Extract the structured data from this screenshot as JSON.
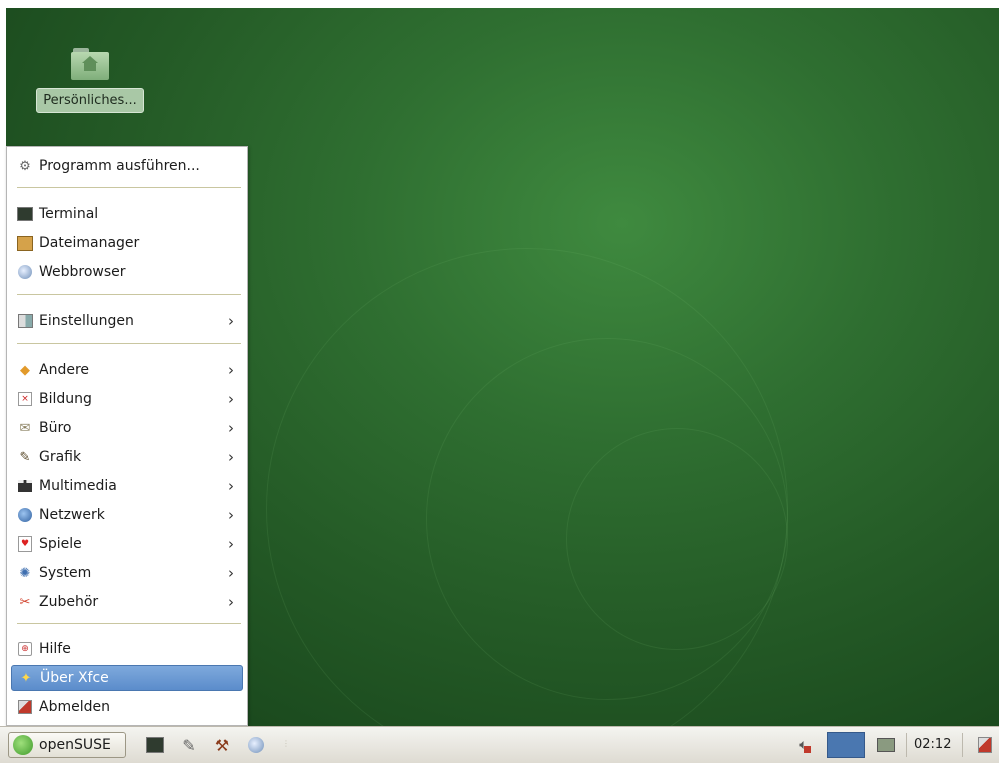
{
  "desktop": {
    "icon_label": "Persönliches..."
  },
  "menu": {
    "run": {
      "label": "Programm ausführen...",
      "icon": "run-program-icon"
    },
    "favorites": [
      {
        "label": "Terminal",
        "icon": "terminal-icon"
      },
      {
        "label": "Dateimanager",
        "icon": "file-manager-icon"
      },
      {
        "label": "Webbrowser",
        "icon": "web-browser-icon"
      }
    ],
    "settings": {
      "label": "Einstellungen",
      "icon": "settings-icon"
    },
    "categories": [
      {
        "label": "Andere",
        "icon": "other-icon"
      },
      {
        "label": "Bildung",
        "icon": "education-icon"
      },
      {
        "label": "Büro",
        "icon": "office-icon"
      },
      {
        "label": "Grafik",
        "icon": "graphics-icon"
      },
      {
        "label": "Multimedia",
        "icon": "multimedia-icon"
      },
      {
        "label": "Netzwerk",
        "icon": "network-icon"
      },
      {
        "label": "Spiele",
        "icon": "games-icon"
      },
      {
        "label": "System",
        "icon": "system-icon"
      },
      {
        "label": "Zubehör",
        "icon": "accessories-icon"
      }
    ],
    "help": {
      "label": "Hilfe",
      "icon": "help-icon"
    },
    "about": {
      "label": "Über Xfce",
      "icon": "about-star-icon"
    },
    "logout": {
      "label": "Abmelden",
      "icon": "logout-icon"
    },
    "submenu_arrow": "›"
  },
  "taskbar": {
    "start_label": "openSUSE",
    "clock": "02:12"
  },
  "colors": {
    "selection": "#5b8ccb",
    "desktop_green": "#2f6f31",
    "workspace": "#4a77b0"
  }
}
